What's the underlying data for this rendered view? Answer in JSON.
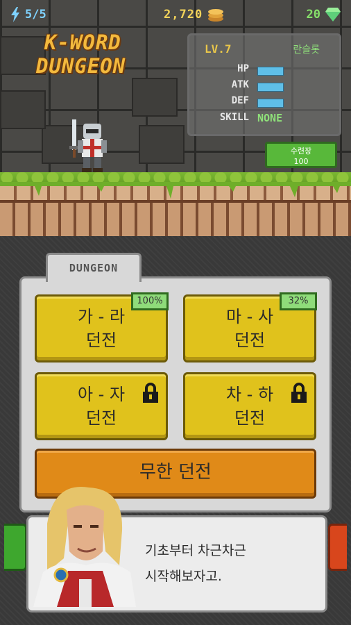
{
  "topbar": {
    "energy": "5/5",
    "gold": "2,720",
    "gems": "20",
    "icons": [
      "lightning-icon",
      "coin-stack-icon",
      "gem-icon"
    ],
    "colors": {
      "energy": "#7fd2ff",
      "gold": "#f3d35a",
      "gems": "#86e06a"
    }
  },
  "logo": {
    "line1": "K-WORD",
    "line2": "DUNGEON"
  },
  "stats": {
    "level": "LV.7",
    "nickname": "란슬롯",
    "rows": [
      {
        "label": "HP",
        "level": 0.5
      },
      {
        "label": "ATK",
        "level": 0.5
      },
      {
        "label": "DEF",
        "level": 0.5
      },
      {
        "label": "SKILL",
        "value": "NONE"
      }
    ],
    "train_button": {
      "line1": "수련장",
      "line2": "100"
    }
  },
  "dungeon": {
    "tab_label": "DUNGEON",
    "buttons": [
      {
        "line1": "가 - 라",
        "line2": "던전",
        "progress": "100%",
        "locked": false
      },
      {
        "line1": "마 - 사",
        "line2": "던전",
        "progress": "32%",
        "locked": false
      },
      {
        "line1": "아 - 자",
        "line2": "던전",
        "locked": true
      },
      {
        "line1": "차 - 하",
        "line2": "던전",
        "locked": true
      }
    ],
    "infinite_label": "무한 던전",
    "colors": {
      "normal": "#e0c21c",
      "infinite": "#e08a18",
      "badge": "#8fdc7a"
    }
  },
  "dialog": {
    "line1": "기초부터 차근차근",
    "line2": "시작해보자고."
  }
}
